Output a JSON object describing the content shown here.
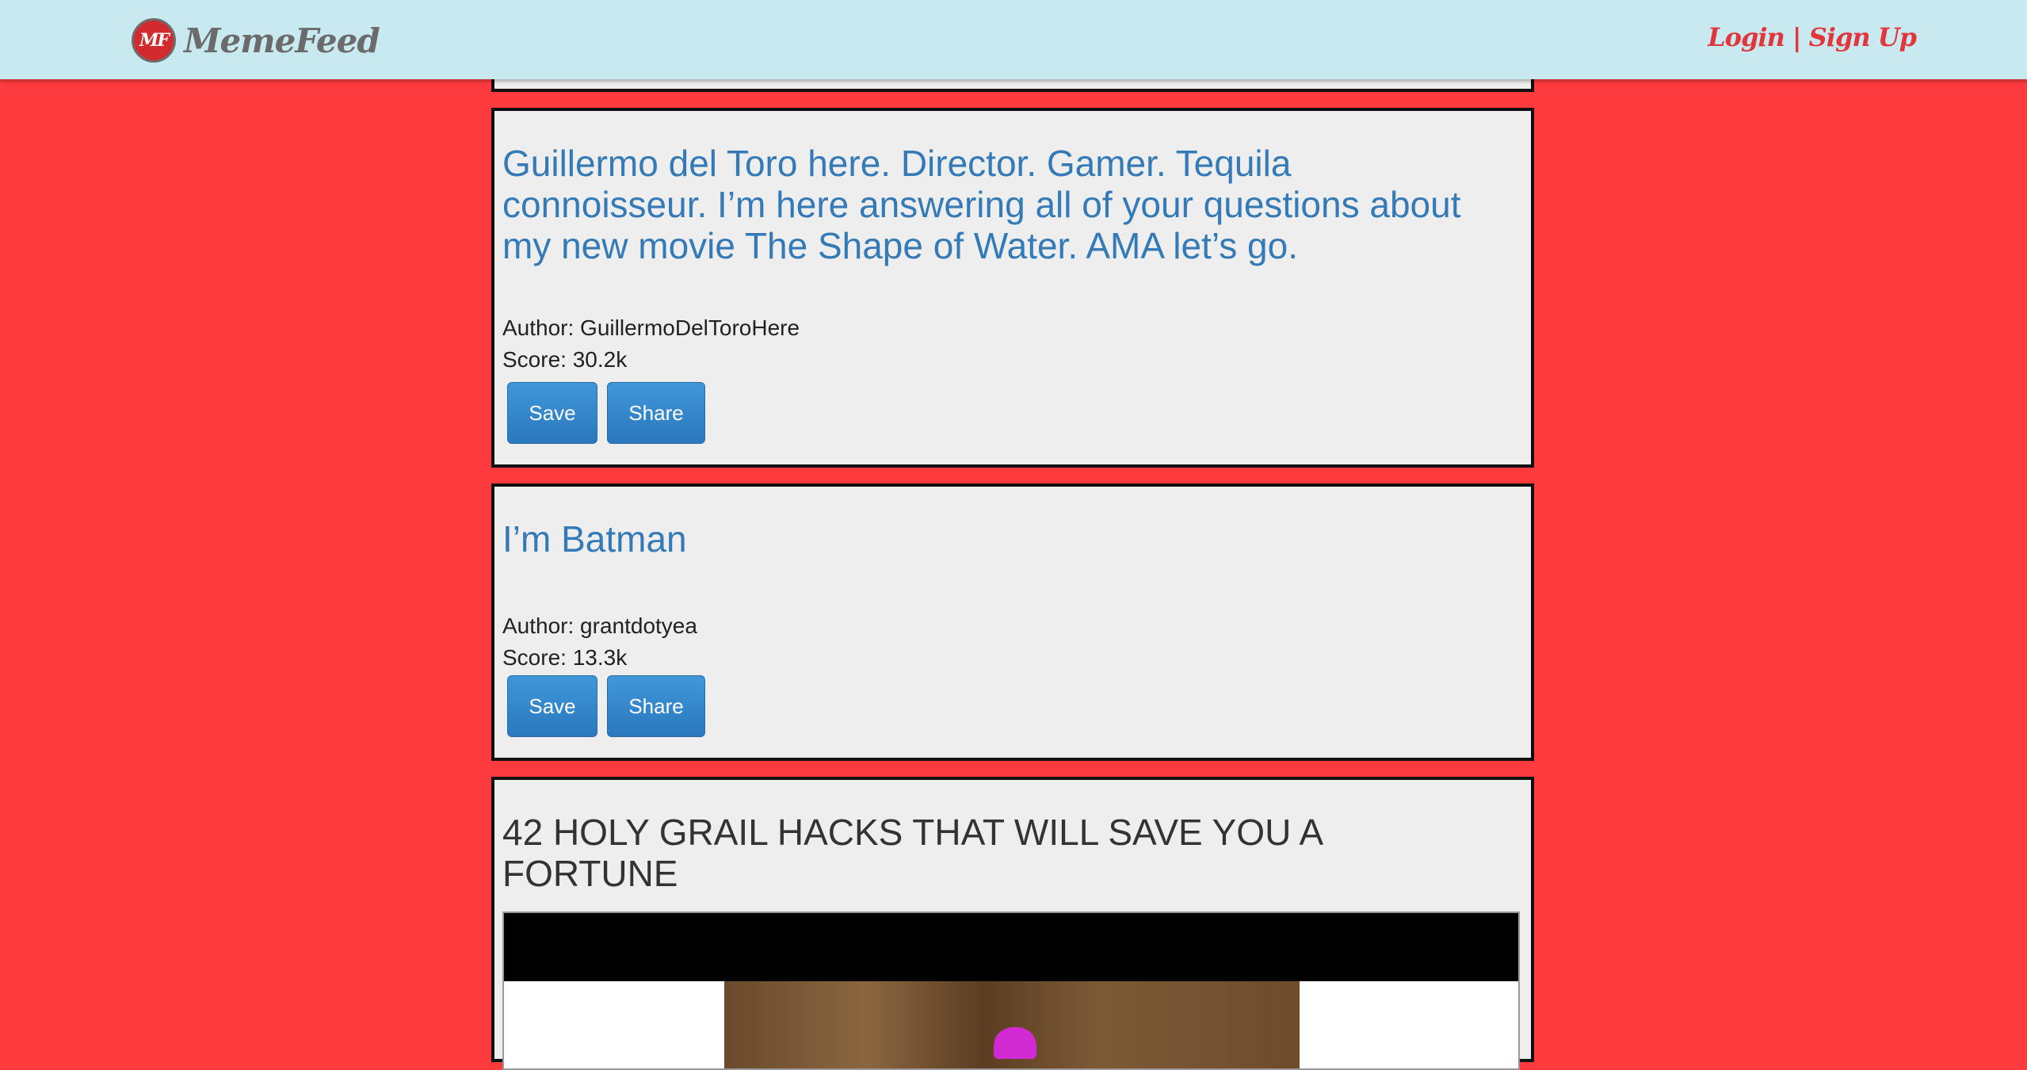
{
  "header": {
    "logo_text": "MF",
    "brand_name": "MemeFeed",
    "login_label": "Login | Sign Up"
  },
  "posts": [
    {
      "title": "Guillermo del Toro here. Director. Gamer. Tequila connoisseur. I’m here answering all of your questions about my new movie The Shape of Water. AMA let’s go.",
      "author": "Author: GuillermoDelToroHere",
      "score": "Score: 30.2k",
      "save_label": "Save",
      "share_label": "Share"
    },
    {
      "title": "I’m Batman",
      "author": "Author: grantdotyea",
      "score": "Score: 13.3k",
      "save_label": "Save",
      "share_label": "Share"
    },
    {
      "title": "42 HOLY GRAIL HACKS THAT WILL SAVE YOU A FORTUNE"
    }
  ],
  "colors": {
    "background": "#fd3b3e",
    "navbar": "#c9e9f1",
    "title_link": "#337ab7",
    "button": "#2f84c9",
    "login": "#e2363c"
  },
  "icons": {
    "logo": "memefeed-logo-icon"
  }
}
